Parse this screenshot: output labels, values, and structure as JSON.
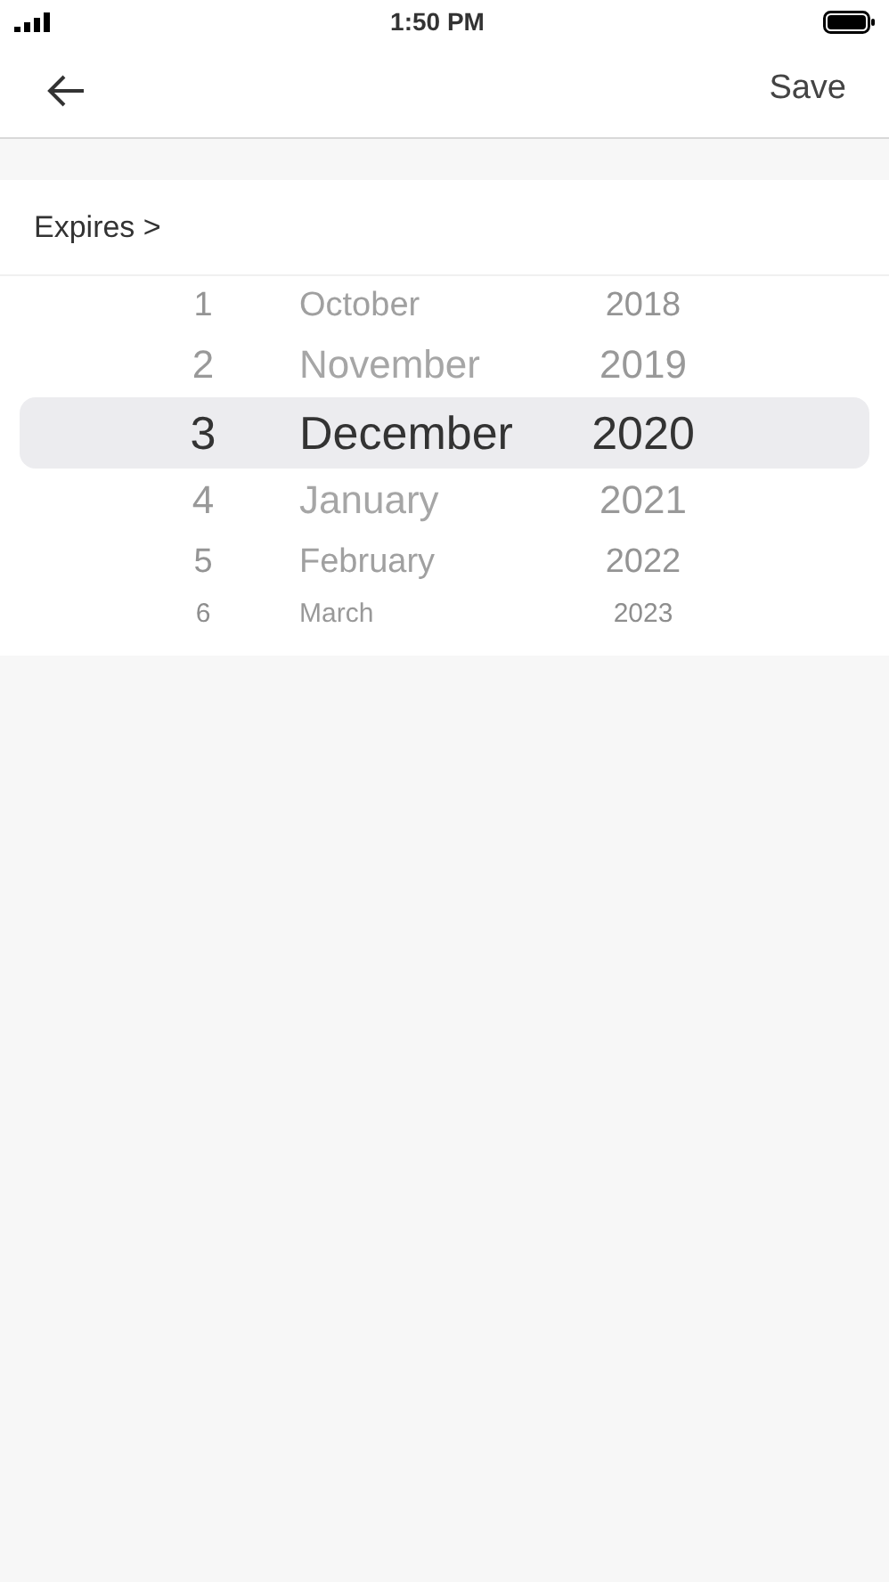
{
  "status_bar": {
    "time": "1:50 PM"
  },
  "nav": {
    "action": "Save"
  },
  "section": {
    "title": "Expires >"
  },
  "picker": {
    "rows": [
      {
        "day": "1",
        "month": "October",
        "year": "2018",
        "selected": false
      },
      {
        "day": "2",
        "month": "November",
        "year": "2019",
        "selected": false
      },
      {
        "day": "3",
        "month": "December",
        "year": "2020",
        "selected": true
      },
      {
        "day": "4",
        "month": "January",
        "year": "2021",
        "selected": false
      },
      {
        "day": "5",
        "month": "February",
        "year": "2022",
        "selected": false
      },
      {
        "day": "6",
        "month": "March",
        "year": "2023",
        "selected": false
      }
    ]
  }
}
